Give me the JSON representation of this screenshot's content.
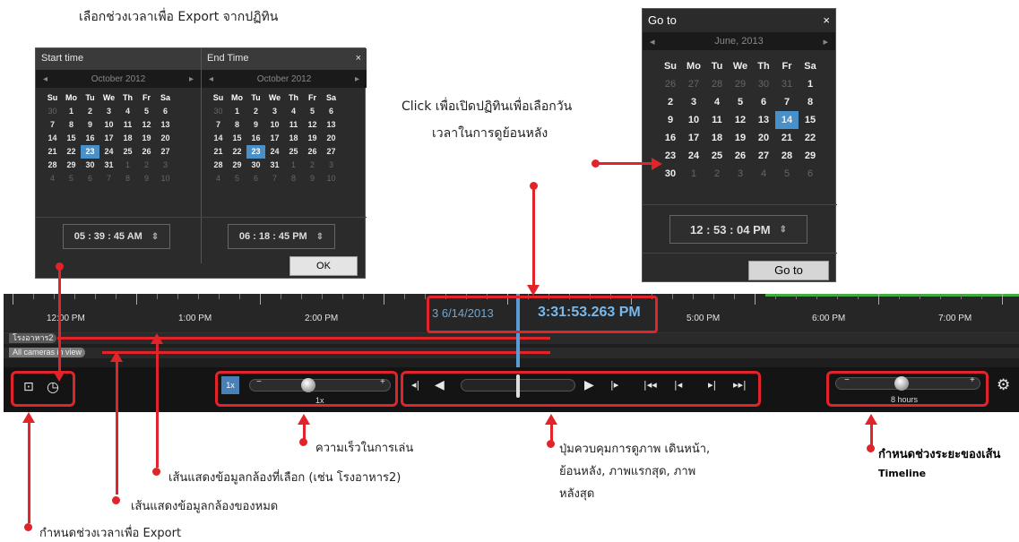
{
  "captions": {
    "export_title": "เลือกช่วงเวลาเพื่อ Export จากปฏิทิน",
    "goto_desc_1": "Click เพื่อเปิดปฏิทินเพื่อเลือกวัน",
    "goto_desc_2": "เวลาในการดูย้อนหลัง",
    "speed": "ความเร็วในการเล่น",
    "selected_camera": "เส้นแสดงข้อมูลกล้องที่เลือก  (เช่น โรงอาหาร2)",
    "all_cameras": "เส้นแสดงข้อมูลกล้องของหมด",
    "export_range": "กำหนดช่วงเวลาเพื่อ Export",
    "playback_1": "ปุ่มควบคุมการดูภาพ เดินหน้า,",
    "playback_2": "ย้อนหลัง, ภาพแรกสุด, ภาพ",
    "playback_3": "หลังสุด",
    "timeline_range_1": "กำหนดช่วงระยะของเส้น",
    "timeline_range_2": "Timeline"
  },
  "export_dialog": {
    "start_title": "Start time",
    "end_title": "End Time",
    "close": "×",
    "start_month": "October 2012",
    "end_month": "October 2012",
    "weekdays": [
      "Su",
      "Mo",
      "Tu",
      "We",
      "Th",
      "Fr",
      "Sa"
    ],
    "start_time": "05 : 39 : 45  AM",
    "end_time": "06 : 18 : 45  PM",
    "ok": "OK"
  },
  "goto_dialog": {
    "title": "Go to",
    "close": "×",
    "month": "June, 2013",
    "weekdays": [
      "Su",
      "Mo",
      "Tu",
      "We",
      "Th",
      "Fr",
      "Sa"
    ],
    "time": "12 : 53 : 04  PM",
    "button": "Go to"
  },
  "timeline": {
    "hours": [
      "12:00 PM",
      "1:00 PM",
      "2:00 PM",
      "5:00 PM",
      "6:00 PM",
      "7:00 PM"
    ],
    "date_partial": "3 6/14/2013",
    "current_time": "3:31:53.263 PM",
    "camera_row_1": "โรงอาหาร2",
    "camera_row_2": "All cameras in view",
    "speed_badge": "1x",
    "speed_value": "1x",
    "range_value": "8 hours",
    "minus": "−",
    "plus": "+"
  }
}
